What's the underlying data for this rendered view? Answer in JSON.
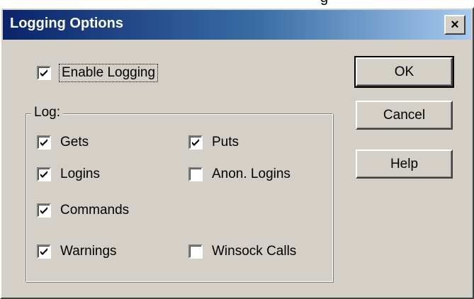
{
  "background_fragment": "g",
  "dialog": {
    "title": "Logging Options",
    "close_label": "×"
  },
  "enable_logging": {
    "label": "Enable Logging",
    "checked": true
  },
  "log_group": {
    "legend": "Log:",
    "items": [
      {
        "label": "Gets",
        "checked": true
      },
      {
        "label": "Puts",
        "checked": true
      },
      {
        "label": "Logins",
        "checked": true
      },
      {
        "label": "Anon. Logins",
        "checked": false
      },
      {
        "label": "Commands",
        "checked": true
      },
      {
        "label": "Warnings",
        "checked": true
      },
      {
        "label": "Winsock Calls",
        "checked": false
      }
    ]
  },
  "buttons": {
    "ok": "OK",
    "cancel": "Cancel",
    "help": "Help"
  },
  "colors": {
    "face": "#d4d0c8",
    "title_start": "#0a246a",
    "title_end": "#a6caf0"
  }
}
